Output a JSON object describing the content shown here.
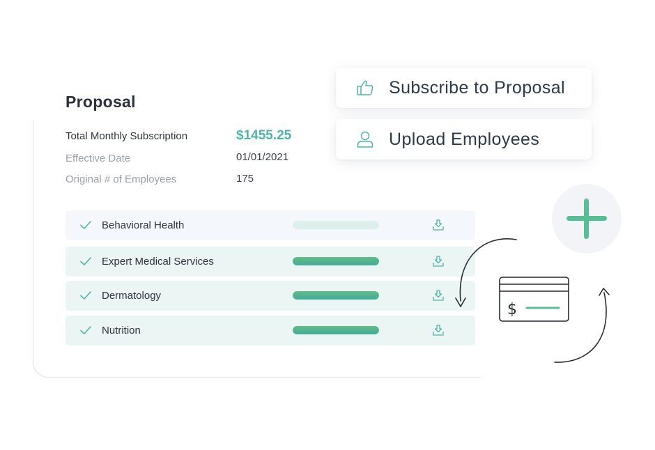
{
  "proposal": {
    "title": "Proposal",
    "total_label": "Total Monthly Subscription",
    "total_value": "$1455.25",
    "effective_label": "Effective Date",
    "effective_value": "01/01/2021",
    "employees_label": "Original # of Employees",
    "employees_value": "175"
  },
  "services": [
    {
      "name": "Behavioral Health",
      "progress": 0.0,
      "icon": "check-icon",
      "action_icon": "download-icon"
    },
    {
      "name": "Expert Medical Services",
      "progress": 1.0,
      "icon": "check-icon",
      "action_icon": "download-icon"
    },
    {
      "name": "Dermatology",
      "progress": 1.0,
      "icon": "check-icon",
      "action_icon": "download-icon"
    },
    {
      "name": "Nutrition",
      "progress": 1.0,
      "icon": "check-icon",
      "action_icon": "download-icon"
    }
  ],
  "actions": {
    "subscribe_label": "Subscribe to Proposal",
    "subscribe_icon": "thumbs-up-icon",
    "upload_label": "Upload Employees",
    "upload_icon": "user-icon"
  },
  "illustration": {
    "add_icon": "plus-icon",
    "card_icon": "credit-card-icon",
    "card_symbol": "$"
  },
  "colors": {
    "accent": "#4fb3a9",
    "progress_green": "#5cbf86",
    "plus_green": "#56bf95",
    "row_light": "#f4f7fb",
    "row_green": "#ebf5f3"
  }
}
